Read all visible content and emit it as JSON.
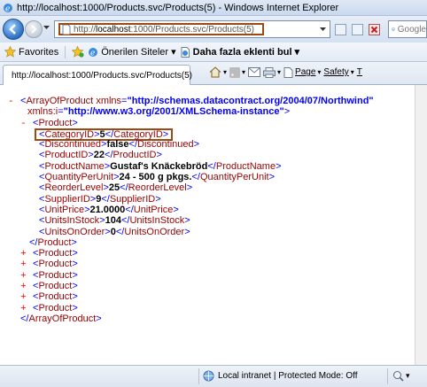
{
  "window": {
    "title": "http://localhost:1000/Products.svc/Products(5) - Windows Internet Explorer"
  },
  "address_bar": {
    "url_prefix": "http://",
    "url_host": "localhost",
    "url_rest": ":1000/Products.svc/Products(5)"
  },
  "search": {
    "placeholder": "Google"
  },
  "favorites_bar": {
    "favorites_label": "Favorites",
    "suggested_label": "Önerilen Siteler ▾",
    "more_addons_label": "Daha fazla eklenti bul ▾"
  },
  "tab": {
    "label": "http://localhost:1000/Products.svc/Products(5)"
  },
  "command_bar": {
    "page_label": "Page",
    "safety_label": "Safety",
    "tools_label": "T"
  },
  "xml": {
    "root_open": "ArrayOfProduct",
    "attr_xmlns_name": "xmlns",
    "attr_xmlns_value": "\"http://schemas.datacontract.org/2004/07/Northwind\"",
    "attr_xmlnsi_name": "xmlns:i",
    "attr_xmlnsi_value": "\"http://www.w3.org/2001/XMLSchema-instance\"",
    "product_tag": "Product",
    "fields": [
      {
        "name": "CategoryID",
        "value": "5"
      },
      {
        "name": "Discontinued",
        "value": "false"
      },
      {
        "name": "ProductID",
        "value": "22"
      },
      {
        "name": "ProductName",
        "value": "Gustaf's Knäckebröd"
      },
      {
        "name": "QuantityPerUnit",
        "value": "24 - 500 g pkgs."
      },
      {
        "name": "ReorderLevel",
        "value": "25"
      },
      {
        "name": "SupplierID",
        "value": "9"
      },
      {
        "name": "UnitPrice",
        "value": "21.0000"
      },
      {
        "name": "UnitsInStock",
        "value": "104"
      },
      {
        "name": "UnitsOnOrder",
        "value": "0"
      }
    ],
    "collapsed_products_count": 6
  },
  "status_bar": {
    "zone_text": "Local intranet | Protected Mode: Off",
    "zoom_label": "▾"
  }
}
